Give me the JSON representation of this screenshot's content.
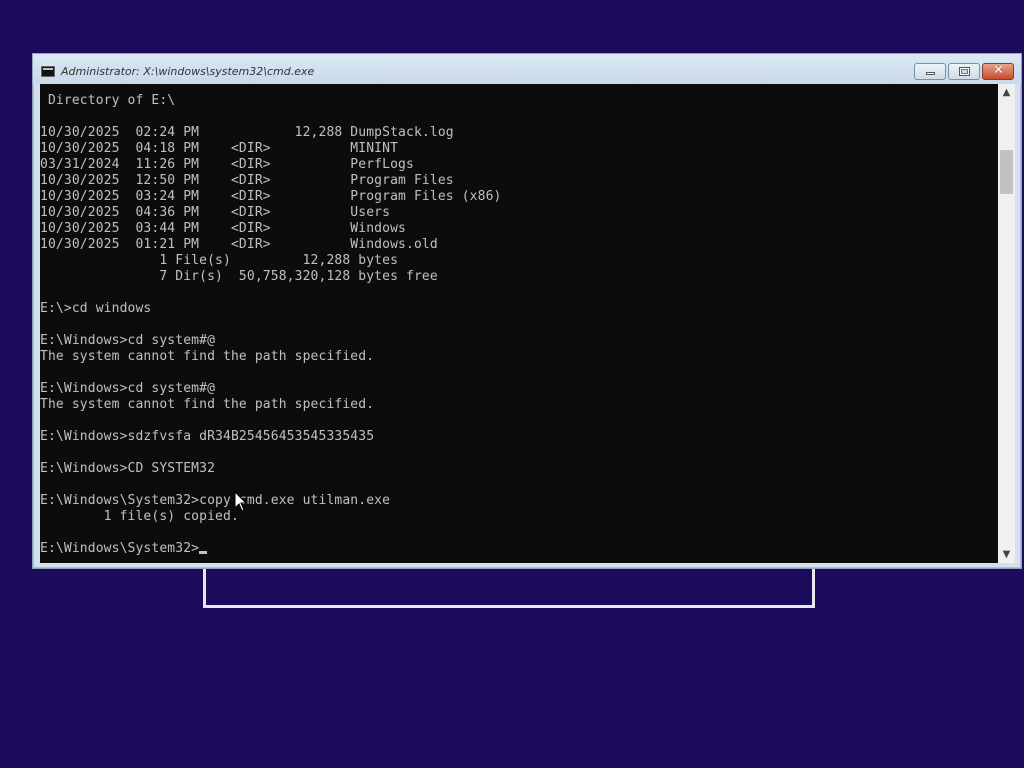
{
  "window": {
    "title": "Administrator: X:\\windows\\system32\\cmd.exe",
    "icon": "cmd-icon",
    "minimize_icon": "minimize-icon",
    "maximize_icon": "maximize-icon",
    "close_glyph": "✕"
  },
  "console": {
    "lines": [
      " Directory of E:\\",
      "",
      "10/30/2025  02:24 PM            12,288 DumpStack.log",
      "10/30/2025  04:18 PM    <DIR>          MININT",
      "03/31/2024  11:26 PM    <DIR>          PerfLogs",
      "10/30/2025  12:50 PM    <DIR>          Program Files",
      "10/30/2025  03:24 PM    <DIR>          Program Files (x86)",
      "10/30/2025  04:36 PM    <DIR>          Users",
      "10/30/2025  03:44 PM    <DIR>          Windows",
      "10/30/2025  01:21 PM    <DIR>          Windows.old",
      "               1 File(s)         12,288 bytes",
      "               7 Dir(s)  50,758,320,128 bytes free",
      "",
      "E:\\>cd windows",
      "",
      "E:\\Windows>cd system#@",
      "The system cannot find the path specified.",
      "",
      "E:\\Windows>cd system#@",
      "The system cannot find the path specified.",
      "",
      "E:\\Windows>sdzfvsfa dR34B25456453545335435",
      "",
      "E:\\Windows>CD SYSTEM32",
      "",
      "E:\\Windows\\System32>copy cmd.exe utilman.exe",
      "        1 file(s) copied.",
      ""
    ],
    "prompt": "E:\\Windows\\System32>"
  },
  "scrollbar": {
    "up_glyph": "▲",
    "down_glyph": "▼"
  },
  "colors": {
    "desktop": "#1c0a5c",
    "console_bg": "#0c0c0c",
    "console_fg": "#c0c0c0"
  }
}
